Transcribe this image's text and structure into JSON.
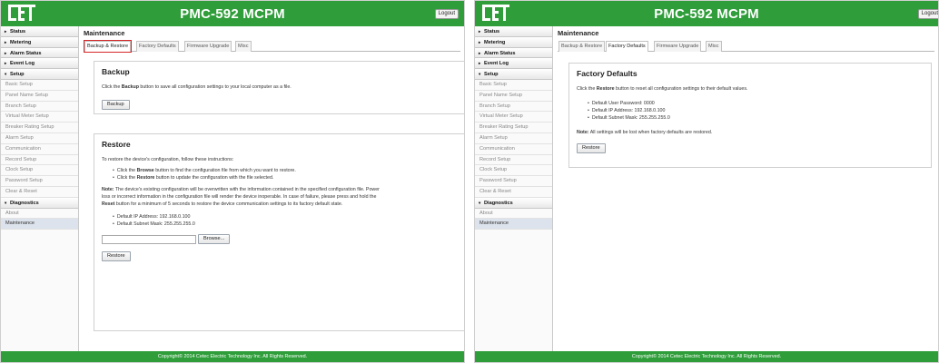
{
  "app": {
    "title": "PMC-592 MCPM",
    "logout_label": "Logout",
    "footer": "Copyright© 2014 Cetec Electric Technology Inc. All Rights Reserved.",
    "brand_color": "#2f9e3a"
  },
  "sidebar": {
    "status": "Status",
    "metering": "Metering",
    "alarm_status": "Alarm Status",
    "event_log": "Event Log",
    "setup": "Setup",
    "setup_items": [
      "Basic Setup",
      "Panel Name Setup",
      "Branch Setup",
      "Virtual Meter Setup",
      "Breaker Rating Setup",
      "Alarm Setup",
      "Communication",
      "Record Setup",
      "Clock Setup",
      "Password Setup",
      "Clear & Reset"
    ],
    "diagnostics": "Diagnostics",
    "diag_items": [
      "About",
      "Maintenance"
    ]
  },
  "main": {
    "page_title": "Maintenance",
    "tabs": [
      "Backup & Restore",
      "Factory Defaults",
      "Firmware Upgrade",
      "Misc"
    ]
  },
  "backup": {
    "title": "Backup",
    "desc_pre": "Click the ",
    "desc_bold": "Backup",
    "desc_post": " button to save all configuration settings to your local computer as a file.",
    "button": "Backup"
  },
  "restore": {
    "title": "Restore",
    "intro": "To restore the device's configuration, follow these instructions:",
    "step1_pre": "Click the ",
    "step1_bold": "Browse",
    "step1_post": " button to find the configuration file from which you want to restore.",
    "step2_pre": "Click the ",
    "step2_bold": "Restore",
    "step2_post": " button to update the configuration with the file selected.",
    "note_label": "Note:",
    "note_line1": " The device's existing configuration will be overwritten with the information contained in the specified configuration file. Power",
    "note_line2": "loss or incorrect information in the configuration file will render the device inoperable. In case of failure, please press and hold the",
    "note_bold": "Reset",
    "note_line3": " button for a minimum of 5 seconds to restore the device communication settings to its factory default state.",
    "default_ip": "Default IP Address: 192.168.0.100",
    "default_mask": "Default Subnet Mask: 255.255.255.0",
    "file_value": "",
    "browse_button": "Browse...",
    "restore_button": "Restore"
  },
  "factory": {
    "title": "Factory Defaults",
    "desc_pre": "Click the ",
    "desc_bold": "Restore",
    "desc_post": " button to reset all configuration settings to their default values.",
    "default_password": "Default User Password: 0000",
    "default_ip": "Default IP Address: 192.168.0.100",
    "default_mask": "Default Subnet Mask: 255.255.255.0",
    "note_label": "Note:",
    "note_text": " All settings will be lost when factory defaults are restored.",
    "button": "Restore"
  }
}
